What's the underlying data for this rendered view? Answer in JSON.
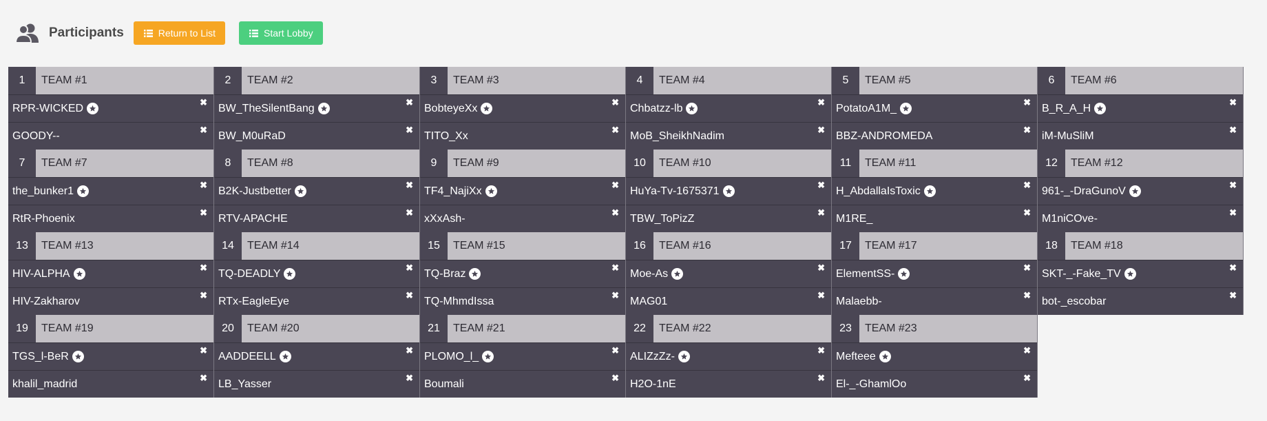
{
  "header": {
    "title": "Participants",
    "return_label": "Return to List",
    "start_label": "Start Lobby"
  },
  "colors": {
    "orange": "#f6a623",
    "green": "#4ccf7f",
    "dark": "#4a4654",
    "header_gray": "#c3c0c5"
  },
  "icons": {
    "people": "people-icon",
    "list": "list-icon",
    "captain": "star-badge-icon",
    "remove": "close-icon"
  },
  "teams": [
    {
      "num": "1",
      "name": "TEAM #1",
      "players": [
        "RPR-WICKED",
        "GOODY--"
      ]
    },
    {
      "num": "2",
      "name": "TEAM #2",
      "players": [
        "BW_TheSilentBang",
        "BW_M0uRaD"
      ]
    },
    {
      "num": "3",
      "name": "TEAM #3",
      "players": [
        "BobteyeXx",
        "TITO_Xx"
      ]
    },
    {
      "num": "4",
      "name": "TEAM #4",
      "players": [
        "Chbatzz-lb",
        "MoB_SheikhNadim"
      ]
    },
    {
      "num": "5",
      "name": "TEAM #5",
      "players": [
        "PotatoA1M_",
        "BBZ-ANDROMEDA"
      ]
    },
    {
      "num": "6",
      "name": "TEAM #6",
      "players": [
        "B_R_A_H",
        "iM-MuSliM"
      ]
    },
    {
      "num": "7",
      "name": "TEAM #7",
      "players": [
        "the_bunker1",
        "RtR-Phoenix"
      ]
    },
    {
      "num": "8",
      "name": "TEAM #8",
      "players": [
        "B2K-Justbetter",
        "RTV-APACHE"
      ]
    },
    {
      "num": "9",
      "name": "TEAM #9",
      "players": [
        "TF4_NajiXx",
        "xXxAsh-"
      ]
    },
    {
      "num": "10",
      "name": "TEAM #10",
      "players": [
        "HuYa-Tv-1675371",
        "TBW_ToPizZ"
      ]
    },
    {
      "num": "11",
      "name": "TEAM #11",
      "players": [
        "H_AbdallaIsToxic",
        "M1RE_"
      ]
    },
    {
      "num": "12",
      "name": "TEAM #12",
      "players": [
        "961-_-DraGunoV",
        "M1niCOve-"
      ]
    },
    {
      "num": "13",
      "name": "TEAM #13",
      "players": [
        "HIV-ALPHA",
        "HIV-Zakharov"
      ]
    },
    {
      "num": "14",
      "name": "TEAM #14",
      "players": [
        "TQ-DEADLY",
        "RTx-EagleEye"
      ]
    },
    {
      "num": "15",
      "name": "TEAM #15",
      "players": [
        "TQ-Braz",
        "TQ-MhmdIssa"
      ]
    },
    {
      "num": "16",
      "name": "TEAM #16",
      "players": [
        "Moe-As",
        "MAG01"
      ]
    },
    {
      "num": "17",
      "name": "TEAM #17",
      "players": [
        "ElementSS-",
        "Malaebb-"
      ]
    },
    {
      "num": "18",
      "name": "TEAM #18",
      "players": [
        "SKT-_-Fake_TV",
        "bot-_escobar"
      ]
    },
    {
      "num": "19",
      "name": "TEAM #19",
      "players": [
        "TGS_l-BeR",
        "khalil_madrid"
      ]
    },
    {
      "num": "20",
      "name": "TEAM #20",
      "players": [
        "AADDEELL",
        "LB_Yasser"
      ]
    },
    {
      "num": "21",
      "name": "TEAM #21",
      "players": [
        "PLOMO_l_",
        "Boumali"
      ]
    },
    {
      "num": "22",
      "name": "TEAM #22",
      "players": [
        "ALIZzZz-",
        "H2O-1nE"
      ]
    },
    {
      "num": "23",
      "name": "TEAM #23",
      "players": [
        "Mefteee",
        "El-_-GhamlOo"
      ]
    }
  ]
}
